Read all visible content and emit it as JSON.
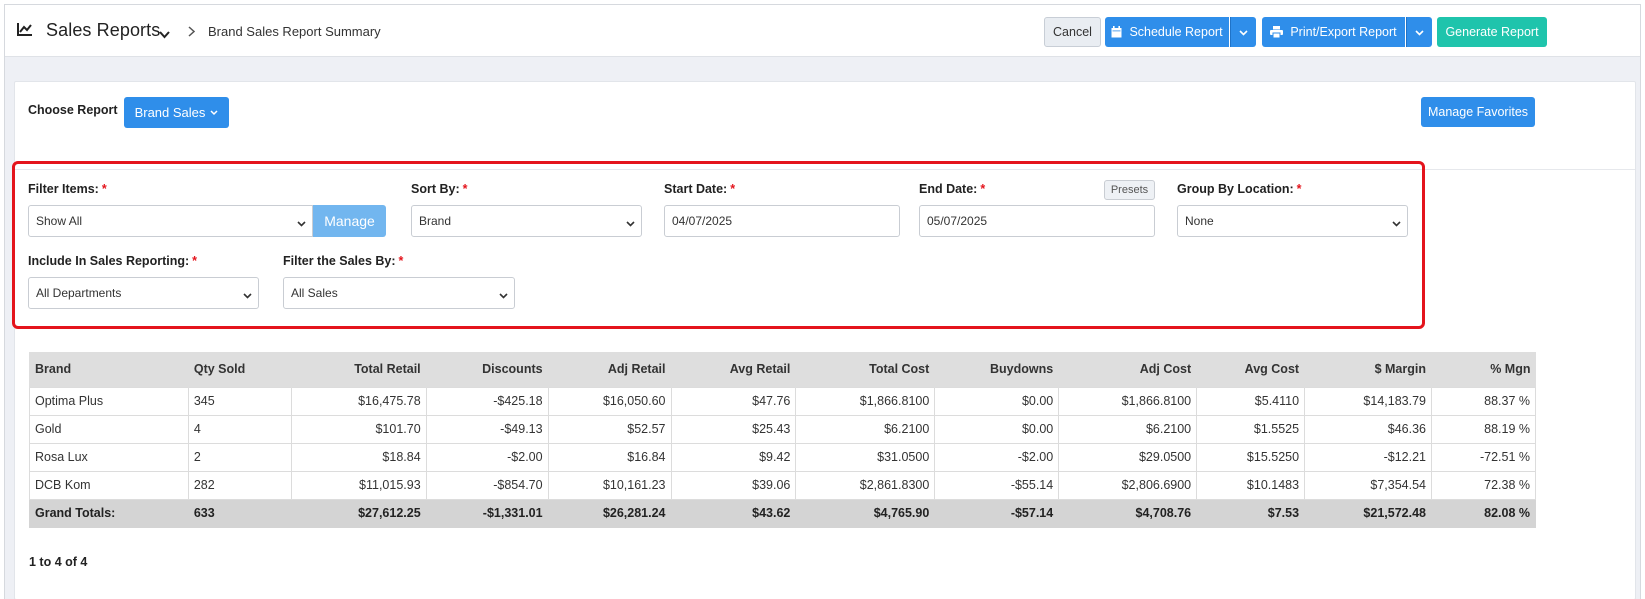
{
  "header": {
    "title": "Sales Reports",
    "breadcrumb": "Brand Sales Report Summary",
    "buttons": {
      "cancel": "Cancel",
      "schedule": "Schedule Report",
      "print_export": "Print/Export Report",
      "generate": "Generate Report"
    }
  },
  "report_chooser": {
    "label": "Choose Report",
    "selected": "Brand Sales",
    "manage_favorites": "Manage Favorites"
  },
  "filters": {
    "filter_items": {
      "label": "Filter Items:",
      "value": "Show All",
      "manage": "Manage"
    },
    "sort_by": {
      "label": "Sort By:",
      "value": "Brand"
    },
    "start_date": {
      "label": "Start Date:",
      "value": "04/07/2025"
    },
    "end_date": {
      "label": "End Date:",
      "value": "05/07/2025",
      "presets": "Presets"
    },
    "group_by_location": {
      "label": "Group By Location:",
      "value": "None"
    },
    "include_in_sales": {
      "label": "Include In Sales Reporting:",
      "value": "All Departments"
    },
    "filter_sales_by": {
      "label": "Filter the Sales By:",
      "value": "All Sales"
    },
    "required_marker": "*"
  },
  "table": {
    "columns": [
      "Brand",
      "Qty Sold",
      "Total Retail",
      "Discounts",
      "Adj Retail",
      "Avg Retail",
      "Total Cost",
      "Buydowns",
      "Adj Cost",
      "Avg Cost",
      "$ Margin",
      "% Mgn"
    ],
    "rows": [
      [
        "Optima Plus",
        "345",
        "$16,475.78",
        "-$425.18",
        "$16,050.60",
        "$47.76",
        "$1,866.8100",
        "$0.00",
        "$1,866.8100",
        "$5.4110",
        "$14,183.79",
        "88.37 %"
      ],
      [
        "Gold",
        "4",
        "$101.70",
        "-$49.13",
        "$52.57",
        "$25.43",
        "$6.2100",
        "$0.00",
        "$6.2100",
        "$1.5525",
        "$46.36",
        "88.19 %"
      ],
      [
        "Rosa Lux",
        "2",
        "$18.84",
        "-$2.00",
        "$16.84",
        "$9.42",
        "$31.0500",
        "-$2.00",
        "$29.0500",
        "$15.5250",
        "-$12.21",
        "-72.51 %"
      ],
      [
        "DCB Kom",
        "282",
        "$11,015.93",
        "-$854.70",
        "$10,161.23",
        "$39.06",
        "$2,861.8300",
        "-$55.14",
        "$2,806.6900",
        "$10.1483",
        "$7,354.54",
        "72.38 %"
      ]
    ],
    "totals": [
      "Grand Totals:",
      "633",
      "$27,612.25",
      "-$1,331.01",
      "$26,281.24",
      "$43.62",
      "$4,765.90",
      "-$57.14",
      "$4,708.76",
      "$7.53",
      "$21,572.48",
      "82.08 %"
    ]
  },
  "pager": "1 to 4 of 4",
  "colors": {
    "primary_blue": "#2f8eea",
    "teal": "#1fc4ac",
    "highlight_red": "#e4141c"
  }
}
